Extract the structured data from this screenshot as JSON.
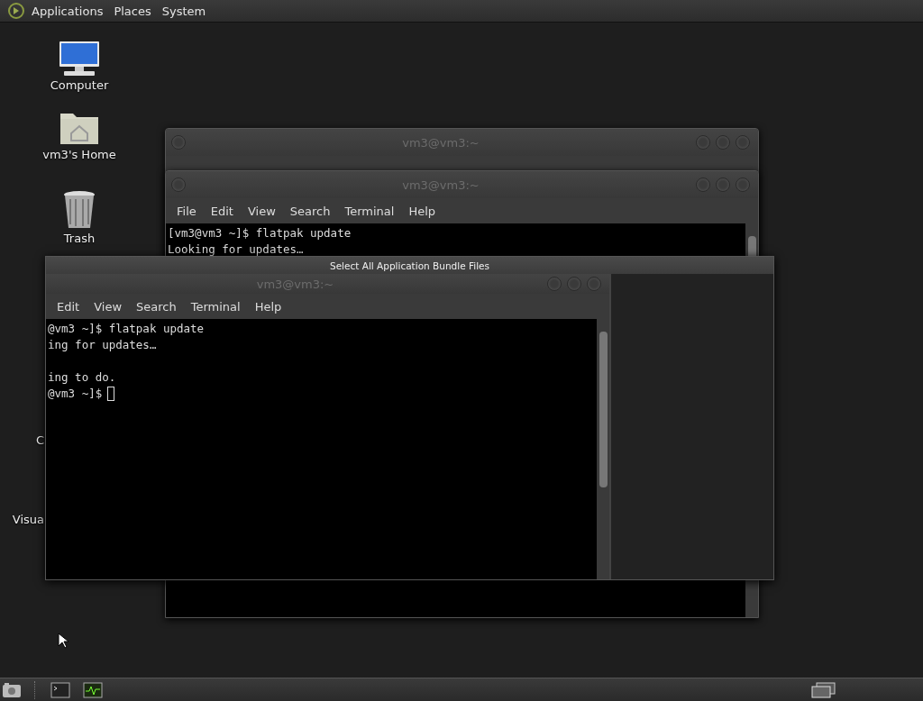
{
  "top_panel": {
    "menus": [
      "Applications",
      "Places",
      "System"
    ]
  },
  "desktop_icons": [
    {
      "label": "Computer",
      "kind": "computer"
    },
    {
      "label": "vm3's Home",
      "kind": "home"
    },
    {
      "label": "Trash",
      "kind": "trash"
    },
    {
      "label": "C",
      "kind": "hidden"
    },
    {
      "label": "Visua",
      "kind": "hidden"
    }
  ],
  "windows": [
    {
      "title": "vm3@vm3:~"
    },
    {
      "title": "vm3@vm3:~",
      "menus": [
        "File",
        "Edit",
        "View",
        "Search",
        "Terminal",
        "Help"
      ],
      "blocks": [
        [
          "[vm3@vm3 ~]$ flatpak update",
          "Looking for updates…"
        ]
      ]
    }
  ],
  "dialog": {
    "title": "Select All Application Bundle Files",
    "window": {
      "title": "vm3@vm3:~",
      "menus": [
        "Edit",
        "View",
        "Search",
        "Terminal",
        "Help"
      ],
      "blocks": [
        [
          "@vm3 ~]$ flatpak update",
          "ing for updates…"
        ],
        [
          "ing to do.",
          "@vm3 ~]$"
        ]
      ],
      "cursor": true
    }
  },
  "bottom_panel": {
    "launchers": [
      {
        "kind": "files"
      },
      {
        "kind": "terminal"
      },
      {
        "kind": "monitor"
      }
    ]
  }
}
